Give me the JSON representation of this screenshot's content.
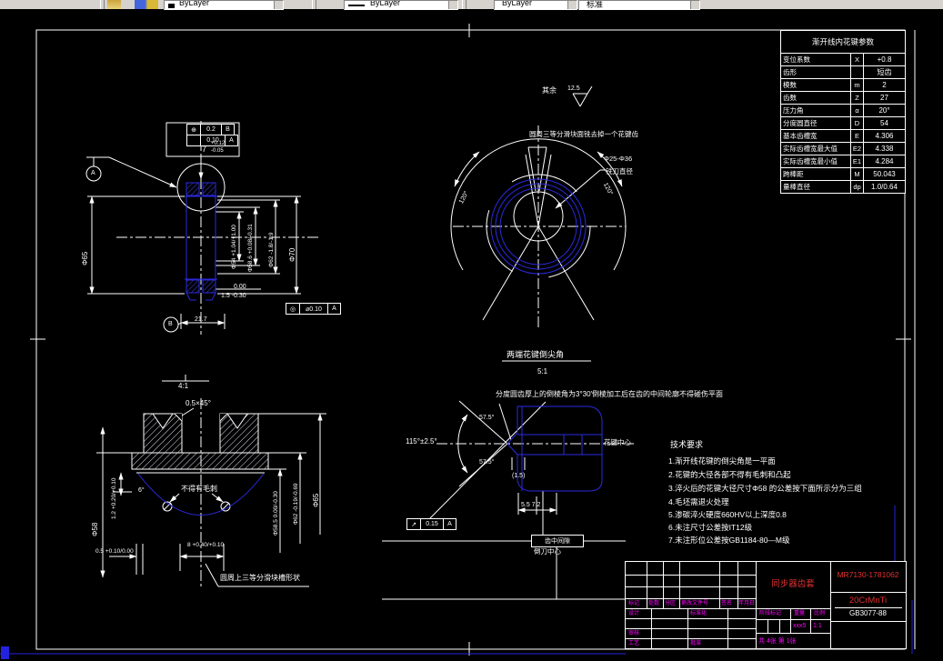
{
  "toolbar": {
    "color_combo": "ByLayer",
    "linetype_combo": "ByLayer",
    "lineweight_combo": "ByLayer",
    "style_combo": "标准"
  },
  "sheet": {
    "surface_prefix": "其余",
    "surface_roughness": "12.5"
  },
  "spline_table": {
    "title": "渐开线内花键参数",
    "rows": [
      {
        "label": "变位系数",
        "sym": "X",
        "value": "+0.8"
      },
      {
        "label": "齿形",
        "sym": "",
        "value": "短齿"
      },
      {
        "label": "模数",
        "sym": "m",
        "value": "2"
      },
      {
        "label": "齿数",
        "sym": "Z",
        "value": "27"
      },
      {
        "label": "压力角",
        "sym": "α",
        "value": "20°"
      },
      {
        "label": "分度圆直径",
        "sym": "D",
        "value": "54"
      },
      {
        "label": "基本齿槽宽",
        "sym": "E",
        "value": "4.306"
      },
      {
        "label": "实际齿槽宽最大值",
        "sym": "E2",
        "value": "4.338"
      },
      {
        "label": "实际齿槽宽最小值",
        "sym": "E1",
        "value": "4.284"
      },
      {
        "label": "跨棒距",
        "sym": "M",
        "value": "50.043"
      },
      {
        "label": "量棒直径",
        "sym": "dp",
        "value": "1.0/0.64"
      }
    ]
  },
  "section_view": {
    "gdt_position": {
      "sym": "⊕",
      "tol": "0.2",
      "datum": "B"
    },
    "gdt_top2": {
      "sym": "",
      "tol": "0.10",
      "datum": "A"
    },
    "width_nominal": "7",
    "width_up": "+0.12",
    "width_dn": "-0.05",
    "datum_a": "A",
    "datum_b": "B",
    "dia65": "Φ65",
    "dia54": "Φ54 +1.04/+1.00",
    "dia586": "Φ58.6 +0.08/-0.31",
    "dia62": "Φ62 -1.8/-1.9",
    "dia70": "Φ70",
    "tol_000": "0.00",
    "dim_15": "1.5 -0.30",
    "dim_217": "21.7",
    "gdt_concentric": {
      "sym": "◎",
      "tol": "⌀0.10",
      "datum": "A"
    }
  },
  "end_view": {
    "note": "圆周三等分滑块面铣去掉一个花键齿",
    "cutter_range": "Φ25-Φ36",
    "cutter_label": "铣刀直径",
    "angle_left": "120°",
    "angle_right": "120°"
  },
  "detail41": {
    "scale": "4:1",
    "chamfer": "0.5×45°",
    "dim12": "1.2 +0.20/+0.10",
    "angle6": "6°",
    "no_burr": "不得有毛刺",
    "dia58": "Φ58",
    "dia585": "Φ58.5 0.00/-0.30",
    "dia62": "Φ62 -0.19/-0.69",
    "dia65": "Φ65",
    "dim05": "0.5 +0.10/0.00",
    "dim8": "8 +0.40/+0.10",
    "note": "圆周上三等分滑块槽形状"
  },
  "detail51": {
    "title": "两端花键倒尖角",
    "scale": "5:1",
    "note": "分度圆齿厚上的倒棱角为3°30′倒棱加工后在齿的中间轮廓不得碰伤平面",
    "angle_total": "115°±2.5°",
    "angle_up": "57.5°",
    "angle_dn": "57.5°",
    "ref15": "(1.5)",
    "dim_5572": "5.5 7.2",
    "gdt": {
      "sym": "↗",
      "tol": "0.15",
      "datum": "A"
    },
    "boxed": "齿中间隙",
    "cutter_center": "倒刀中心",
    "spline_center": "花键中心"
  },
  "tech_req": {
    "title": "技术要求",
    "lines": [
      "1.渐开线花键的倒尖角是一平面",
      "2.花键的大径各部不得有毛刺和凸起",
      "3.淬火后的花键大径尺寸Φ58 的公差按下面所示分为三组",
      "4.毛坯需退火处理",
      "5.渗碳淬火硬度660HV以上深度0.8",
      "6.未注尺寸公差按IT12级",
      "7.未注形位公差按GB1184-80—M级"
    ]
  },
  "title_block": {
    "rev_headers": [
      "标记",
      "处数",
      "分区",
      "更改文件号",
      "签名",
      "年月日"
    ],
    "design": "设计",
    "standardize": "标准化",
    "check": "审核",
    "process": "工艺",
    "approve": "批准",
    "stage_label": "阶段标记",
    "weight_label": "重量",
    "scale_label": "比例",
    "weight_value": "xxx5",
    "scale_value": "1:1",
    "sheet_info": "共 4张 第 1张",
    "part_name": "同步器齿套",
    "drawing_no": "MR7130-1781062",
    "material": "20CrMnTi",
    "material_std": "GB3077-88"
  }
}
